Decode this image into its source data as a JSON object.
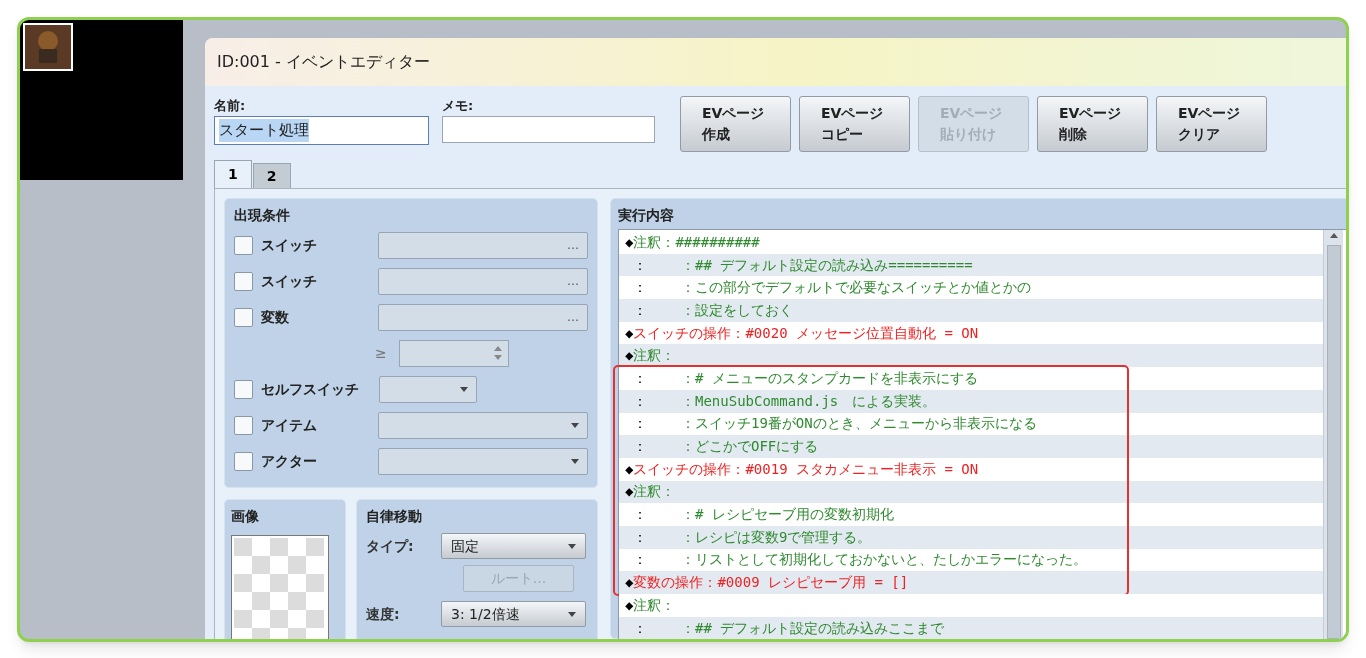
{
  "window": {
    "title": "ID:001 - イベントエディター"
  },
  "name_field": {
    "label": "名前:",
    "value": "スタート処理"
  },
  "memo_field": {
    "label": "メモ:"
  },
  "page_buttons": [
    {
      "line1": "EVページ",
      "line2": "作成",
      "disabled": false
    },
    {
      "line1": "EVページ",
      "line2": "コピー",
      "disabled": false
    },
    {
      "line1": "EVページ",
      "line2": "貼り付け",
      "disabled": true
    },
    {
      "line1": "EVページ",
      "line2": "削除",
      "disabled": false
    },
    {
      "line1": "EVページ",
      "line2": "クリア",
      "disabled": false
    }
  ],
  "tabs": [
    {
      "label": "1",
      "selected": true
    },
    {
      "label": "2",
      "selected": false
    }
  ],
  "conditions": {
    "title": "出現条件",
    "items": [
      {
        "kind": "picker",
        "label": "スイッチ",
        "checked": false,
        "button": "…"
      },
      {
        "kind": "picker",
        "label": "スイッチ",
        "checked": false,
        "button": "…"
      },
      {
        "kind": "picker",
        "label": "変数",
        "checked": false,
        "button": "…"
      },
      {
        "kind": "number",
        "symbol": "≥"
      },
      {
        "kind": "short_dropdown",
        "label": "セルフスイッチ",
        "checked": false
      },
      {
        "kind": "dropdown",
        "label": "アイテム",
        "checked": false
      },
      {
        "kind": "dropdown",
        "label": "アクター",
        "checked": false
      }
    ]
  },
  "image": {
    "title": "画像"
  },
  "autonomous": {
    "title": "自律移動",
    "type": {
      "label": "タイプ:",
      "value": "固定"
    },
    "route_button": {
      "label": "ルート...",
      "disabled": true
    },
    "speed": {
      "label": "速度:",
      "value": "3: 1/2倍速"
    }
  },
  "contents": {
    "title": "実行内容",
    "blocks": [
      {
        "highlighted": false,
        "lines": [
          {
            "kind": "comment",
            "marker": "◆",
            "head": "注釈：",
            "text": "##########"
          },
          {
            "kind": "continuation",
            "marker": "：",
            "text": "：## デフォルト設定の読み込み=========="
          },
          {
            "kind": "continuation",
            "marker": "：",
            "text": "：この部分でデフォルトで必要なスイッチとか値とかの"
          },
          {
            "kind": "continuation",
            "marker": "：",
            "text": "：設定をしておく"
          },
          {
            "kind": "command",
            "marker": "◆",
            "head": "スイッチの操作：",
            "text": "#0020 メッセージ位置自動化 = ON"
          },
          {
            "kind": "comment",
            "marker": "◆",
            "head": "注釈："
          }
        ]
      },
      {
        "highlighted": true,
        "lines": [
          {
            "kind": "continuation",
            "marker": "：",
            "text": "：# メニューのスタンプカードを非表示にする"
          },
          {
            "kind": "continuation",
            "marker": "：",
            "text": "：MenuSubCommand.js　による実装。"
          },
          {
            "kind": "continuation",
            "marker": "：",
            "text": "：スイッチ19番がONのとき、メニューから非表示になる"
          },
          {
            "kind": "continuation",
            "marker": "：",
            "text": "：どこかでOFFにする"
          },
          {
            "kind": "command",
            "marker": "◆",
            "head": "スイッチの操作：",
            "text": "#0019 スタカメニュー非表示 = ON"
          },
          {
            "kind": "comment",
            "marker": "◆",
            "head": "注釈："
          },
          {
            "kind": "continuation",
            "marker": "：",
            "text": "：# レシピセーブ用の変数初期化"
          },
          {
            "kind": "continuation",
            "marker": "：",
            "text": "：レシピは変数9で管理する。"
          },
          {
            "kind": "continuation",
            "marker": "：",
            "text": "：リストとして初期化しておかないと、たしかエラーになった。"
          },
          {
            "kind": "command",
            "marker": "◆",
            "head": "変数の操作：",
            "text": "#0009 レシピセーブ用 = []"
          }
        ]
      },
      {
        "highlighted": false,
        "lines": [
          {
            "kind": "comment",
            "marker": "◆",
            "head": "注釈："
          },
          {
            "kind": "continuation",
            "marker": "：",
            "text": "：## デフォルト設定の読み込みここまで"
          }
        ]
      }
    ]
  }
}
